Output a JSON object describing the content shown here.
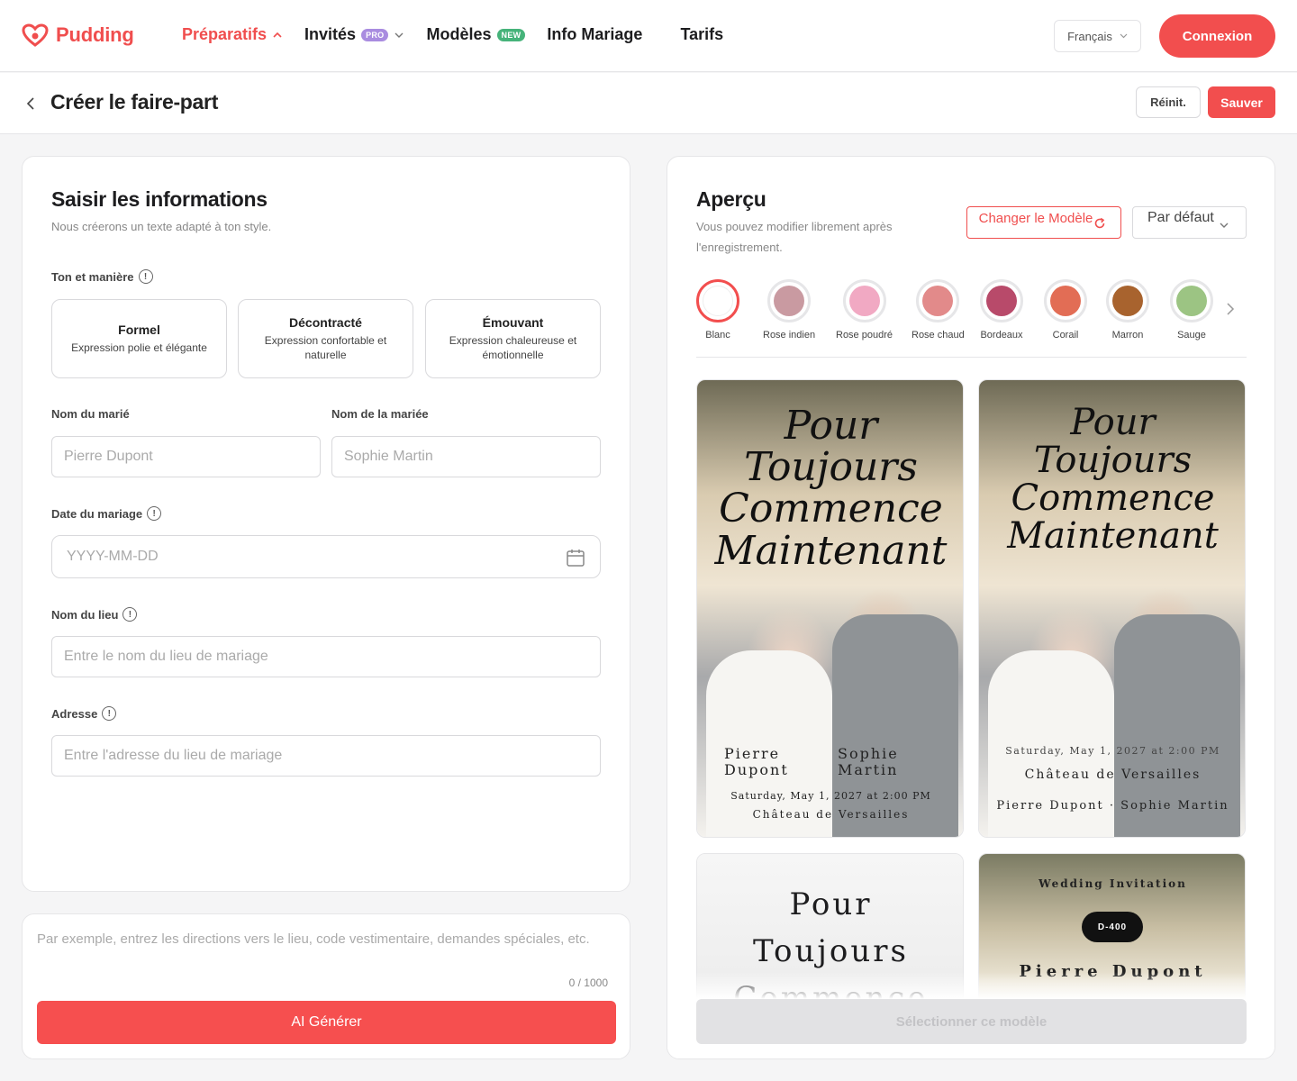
{
  "header": {
    "logo_text": "Pudding",
    "nav": [
      {
        "label": "Préparatifs",
        "active": true,
        "icon": "chevron-up-icon"
      },
      {
        "label": "Invités",
        "badge": "PRO",
        "icon": "chevron-down-icon"
      },
      {
        "label": "Modèles",
        "badge": "NEW"
      },
      {
        "label": "Info Mariage"
      },
      {
        "label": "Tarifs"
      }
    ],
    "language": "Français",
    "login_label": "Connexion"
  },
  "subheader": {
    "title": "Créer le faire-part",
    "reset_label": "Réinit.",
    "save_label": "Sauver"
  },
  "form": {
    "title": "Saisir les informations",
    "subtitle": "Nous créerons un texte adapté à ton style.",
    "tone_label": "Ton et manière",
    "tones": [
      {
        "title": "Formel",
        "desc": "Expression polie et élégante"
      },
      {
        "title": "Décontracté",
        "desc": "Expression confortable et naturelle"
      },
      {
        "title": "Émouvant",
        "desc": "Expression chaleureuse et émotionnelle"
      }
    ],
    "groom_label": "Nom du marié",
    "groom_placeholder": "Pierre Dupont",
    "bride_label": "Nom de la mariée",
    "bride_placeholder": "Sophie Martin",
    "date_label": "Date du mariage",
    "date_placeholder": "YYYY-MM-DD",
    "venue_label": "Nom du lieu",
    "venue_placeholder": "Entre le nom du lieu de mariage",
    "address_label": "Adresse",
    "address_placeholder": "Entre l'adresse du lieu de mariage"
  },
  "notes": {
    "placeholder": "Par exemple, entrez les directions vers le lieu, code vestimentaire, demandes spéciales, etc.",
    "counter": "0 / 1000",
    "ai_button": "AI Générer"
  },
  "preview": {
    "title": "Aperçu",
    "subtitle_line1": "Vous pouvez modifier librement après",
    "subtitle_line2": "l'enregistrement.",
    "change_template": "Changer le Modèle",
    "default_select": "Par défaut",
    "colors": [
      {
        "name": "Blanc",
        "hex": "#ffffff",
        "selected": true
      },
      {
        "name": "Rose indien",
        "hex": "#c99aa1"
      },
      {
        "name": "Rose poudré",
        "hex": "#f1a9c3"
      },
      {
        "name": "Rose chaud",
        "hex": "#e28a8a"
      },
      {
        "name": "Bordeaux",
        "hex": "#b84a6a"
      },
      {
        "name": "Corail",
        "hex": "#e26d55"
      },
      {
        "name": "Marron",
        "hex": "#a8632e"
      },
      {
        "name": "Sauge",
        "hex": "#9cc483"
      }
    ],
    "templates": [
      {
        "headline": "Pour Toujours Commence Maintenant",
        "groom": "Pierre Dupont",
        "bride": "Sophie Martin",
        "date": "Saturday, May 1, 2027 at 2:00 PM",
        "venue": "Château de Versailles"
      },
      {
        "headline": "Pour Toujours Commence Maintenant",
        "date": "Saturday, May 1, 2027 at 2:00 PM",
        "venue": "Château de Versailles",
        "names": "Pierre Dupont · Sophie Martin"
      },
      {
        "headline": "Pour Toujours Commence"
      },
      {
        "label": "Wedding Invitation",
        "countdown": "D-400",
        "groom": "Pierre Dupont"
      }
    ],
    "select_button": "Sélectionner ce modèle"
  }
}
